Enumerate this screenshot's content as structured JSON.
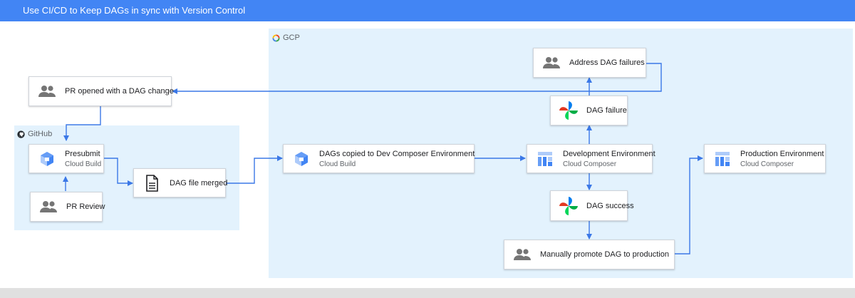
{
  "header": {
    "title": "Use CI/CD to Keep DAGs in sync with Version Control"
  },
  "regions": {
    "gcp": {
      "label": "GCP"
    },
    "github": {
      "label": "GitHub"
    }
  },
  "nodes": {
    "pr_opened": {
      "title": "PR opened with a DAG change",
      "icon": "people-icon"
    },
    "presubmit": {
      "title": "Presubmit",
      "subtitle": "Cloud Build",
      "icon": "cloud-build-icon"
    },
    "pr_review": {
      "title": "PR Review",
      "icon": "people-icon"
    },
    "dag_merged": {
      "title": "DAG file merged",
      "icon": "document-icon"
    },
    "dags_copied": {
      "title": "DAGs copied to Dev Composer Environment",
      "subtitle": "Cloud Build",
      "icon": "cloud-build-icon"
    },
    "dev_env": {
      "title": "Development Environment",
      "subtitle": "Cloud Composer",
      "icon": "cloud-composer-icon"
    },
    "dag_failure": {
      "title": "DAG failure",
      "icon": "airflow-icon"
    },
    "address_failures": {
      "title": "Address DAG failures",
      "icon": "people-icon"
    },
    "dag_success": {
      "title": "DAG success",
      "icon": "airflow-icon"
    },
    "promote": {
      "title": "Manually promote DAG to production",
      "icon": "people-icon"
    },
    "prod_env": {
      "title": "Production Environment",
      "subtitle": "Cloud Composer",
      "icon": "cloud-composer-icon"
    }
  },
  "colors": {
    "header": "#4285f4",
    "region_fill": "#e3f2fd",
    "arrow": "#3b78e7"
  }
}
